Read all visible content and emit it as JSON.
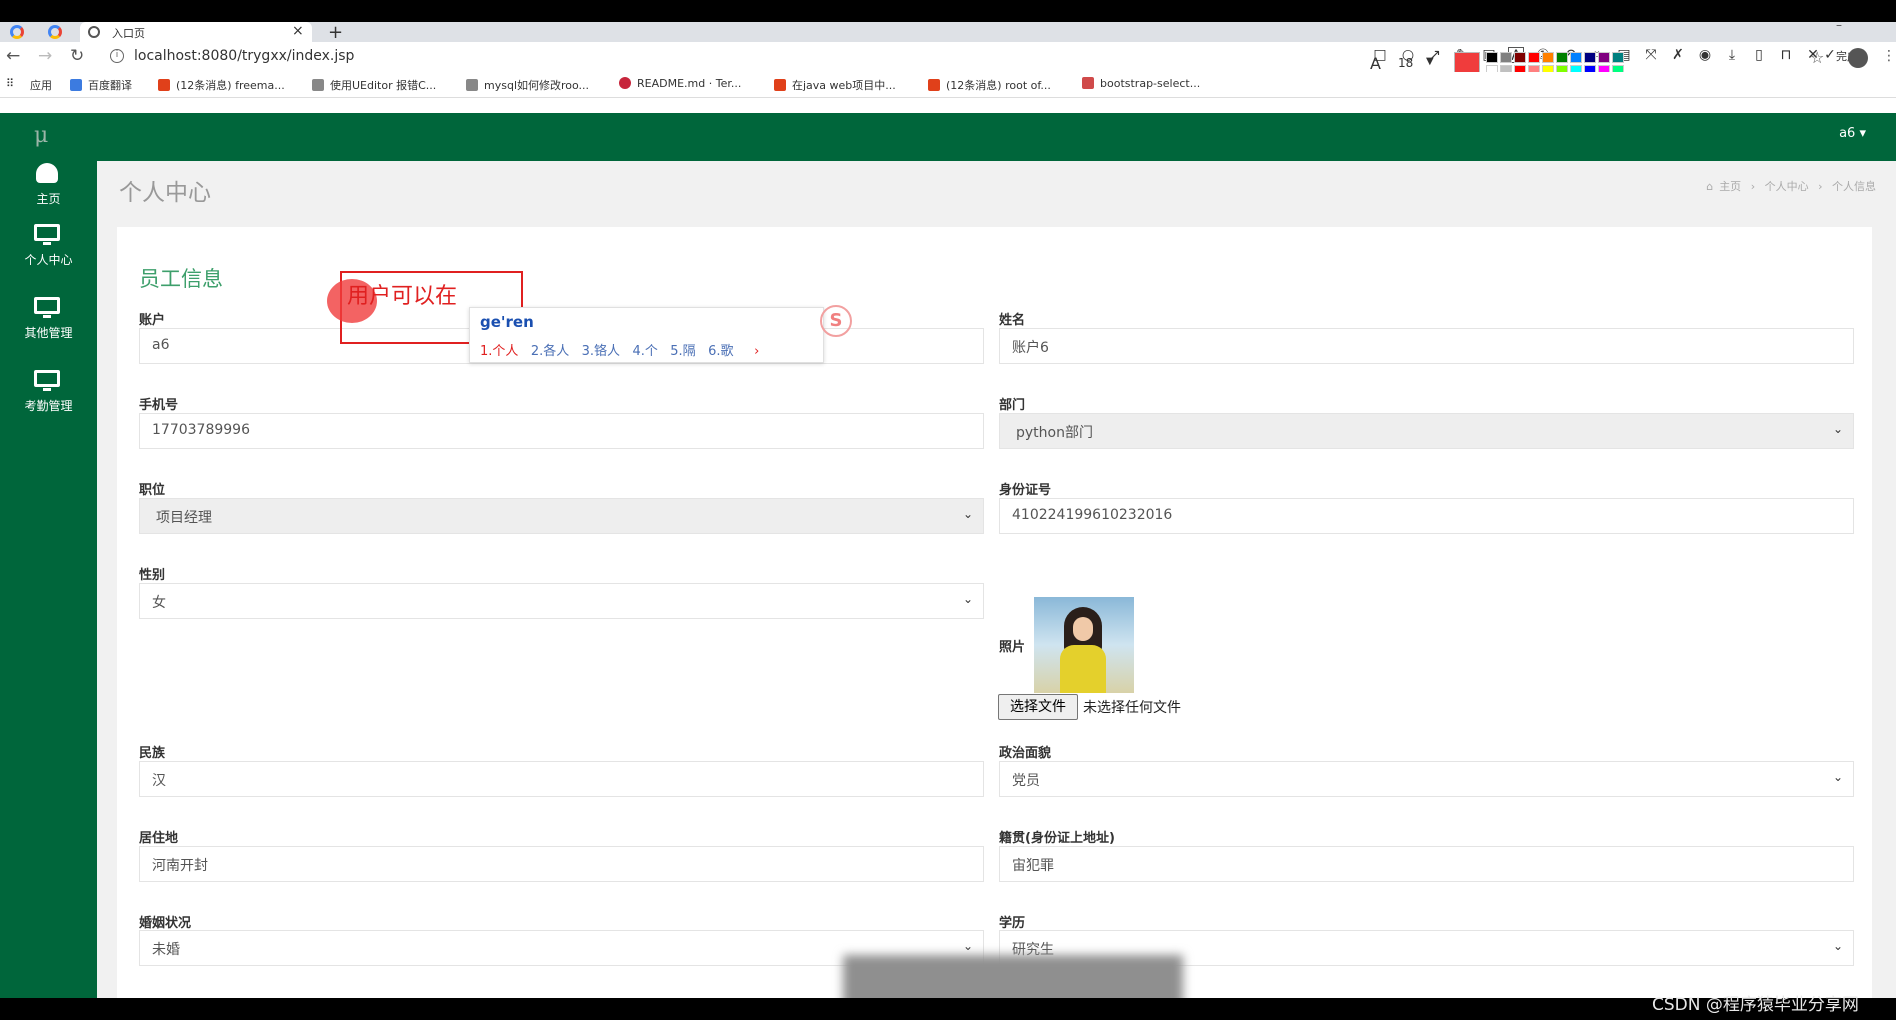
{
  "browser": {
    "tab_title": "入口页",
    "url": "localhost:8080/trygxx/index.jsp",
    "bookmarks": [
      "应用",
      "百度翻译",
      "(12条消息) freema...",
      "使用UEditor 报错C...",
      "mysql如何修改roo...",
      "README.md · Ter...",
      "在java web项目中...",
      "(12条消息) root of...",
      "bootstrap-select..."
    ],
    "annotation_toolbar": {
      "done_label": "完成",
      "font_size": "18",
      "current_color": "#f03c3c",
      "palette": [
        "#000000",
        "#808080",
        "#800000",
        "#ff0000",
        "#ff8000",
        "#008000",
        "#0080ff",
        "#000080",
        "#800080",
        "#008080",
        "#ffffff",
        "#c0c0c0",
        "#ff0000",
        "#ff8080",
        "#ffff00",
        "#80ff00",
        "#00ffff",
        "#0000ff",
        "#ff00ff",
        "#00ff80"
      ]
    }
  },
  "app": {
    "logo": "μ",
    "brand_color": "#00663b",
    "sidebar": [
      {
        "label": "主页",
        "icon": "dashboard-icon"
      },
      {
        "label": "个人中心",
        "icon": "monitor-icon"
      },
      {
        "label": "其他管理",
        "icon": "monitor-icon"
      },
      {
        "label": "考勤管理",
        "icon": "monitor-icon"
      }
    ],
    "user": "a6 ▾"
  },
  "page": {
    "title": "个人中心",
    "breadcrumb": [
      "主页",
      "个人中心",
      "个人信息"
    ],
    "panel_title": "员工信息"
  },
  "form": {
    "account": {
      "label": "账户",
      "value": "a6"
    },
    "name": {
      "label": "姓名",
      "value": "账户6"
    },
    "phone": {
      "label": "手机号",
      "value": "17703789996"
    },
    "department": {
      "label": "部门",
      "value": "python部门"
    },
    "position": {
      "label": "职位",
      "value": "项目经理"
    },
    "id_number": {
      "label": "身份证号",
      "value": "410224199610232016"
    },
    "gender": {
      "label": "性别",
      "value": "女"
    },
    "photo": {
      "label": "照片",
      "button": "选择文件",
      "status": "未选择任何文件"
    },
    "ethnicity": {
      "label": "民族",
      "value": "汉"
    },
    "political_status": {
      "label": "政治面貌",
      "value": "党员"
    },
    "residence": {
      "label": "居住地",
      "value": "河南开封"
    },
    "native_place": {
      "label": "籍贯(身份证上地址)",
      "value": "宙犯罪"
    },
    "marital_status": {
      "label": "婚姻状况",
      "value": "未婚"
    },
    "education": {
      "label": "学历",
      "value": "研究生"
    }
  },
  "overlay": {
    "annotation_text": "用户可以在",
    "ime_pinyin": "ge'ren",
    "ime_candidates": [
      "1.个人",
      "2.各人",
      "3.铬人",
      "4.个",
      "5.隔",
      "6.歌"
    ],
    "ime_more": "›",
    "ime_logo": "S"
  },
  "watermark": "CSDN @程序猿毕业分享网"
}
